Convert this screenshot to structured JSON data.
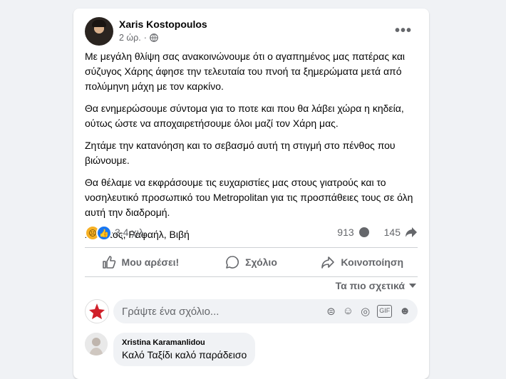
{
  "post": {
    "author": "Xaris Kostopoulos",
    "time": "2 ώρ.",
    "dot": "·",
    "paragraphs": [
      "Με μεγάλη θλίψη σας ανακοινώνουμε ότι ο αγαπημένος μας πατέρας και σύζυγος Χάρης άφησε την τελευταία του πνοή τα ξημερώματα μετά από πολύμηνη μάχη με τον καρκίνο.",
      "Θα ενημερώσουμε σύντομα για το ποτε και που θα λάβει χώρα η κηδεία, ούτως ώστε να αποχαιρετήσουμε όλοι μαζί τον Χάρη μας.",
      "Ζητάμε την κατανόηση και το σεβασμό αυτή τη στιγμή στο πένθος που βιώνουμε.",
      "Θα θέλαμε να εκφράσουμε τις ευχαριστίες μας στους γιατρούς και το νοσηλευτικό προσωπικό του Metropolitan για τις προσπάθειες τους σε όλη αυτή την διαδρομή.",
      "Χρήστος, Ραφαήλ, Βιβή"
    ]
  },
  "stats": {
    "reactions": "3,4 χιλ.",
    "comments": "913",
    "shares": "145"
  },
  "actions": {
    "like": "Μου αρέσει!",
    "comment": "Σχόλιο",
    "share": "Κοινοποίηση"
  },
  "sort_label": "Τα πιο σχετικά",
  "composer": {
    "placeholder": "Γράψτε ένα σχόλιο..."
  },
  "comment": {
    "name": "Xristina Karamanlidou",
    "text": "Καλό Ταξίδι καλό παράδεισο"
  },
  "colors": {
    "background": "#f0f2f5",
    "card": "#ffffff",
    "secondary_text": "#65676b",
    "like_blue": "#1877f2",
    "sad_yellow": "#f7b125"
  },
  "icons": [
    "globe-icon",
    "more-icon",
    "sad-reaction-icon",
    "like-reaction-icon",
    "comment-icon",
    "share-icon",
    "caret-down-icon",
    "sticker-icon",
    "emoji-icon",
    "camera-icon",
    "gif-icon",
    "avatar-sticker-icon"
  ]
}
